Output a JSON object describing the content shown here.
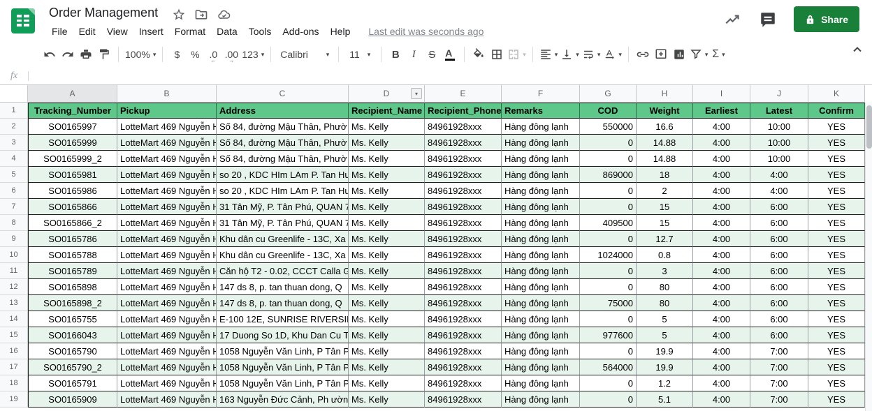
{
  "titlebar": {
    "title": "Order Management",
    "menus": [
      "File",
      "Edit",
      "View",
      "Insert",
      "Format",
      "Data",
      "Tools",
      "Add-ons",
      "Help"
    ],
    "last_edit": "Last edit was seconds ago",
    "share_label": "Share"
  },
  "toolbar": {
    "zoom": "100%",
    "currency": "$",
    "percent": "%",
    "decimal_decrease": ".0",
    "decimal_increase": ".00",
    "more_formats": "123",
    "font_name": "Calibri",
    "font_size": "11",
    "bold": "B",
    "italic": "I",
    "strikethrough": "S",
    "text_color": "A",
    "functions": "Σ"
  },
  "formula_bar": {
    "fx_label": "fx",
    "value": ""
  },
  "grid": {
    "column_letters": [
      "A",
      "B",
      "C",
      "D",
      "E",
      "F",
      "G",
      "H",
      "I",
      "J",
      "K"
    ],
    "selected_column": "A",
    "filter_dropdown_column": "D",
    "row_numbers": [
      1,
      2,
      3,
      4,
      5,
      6,
      7,
      8,
      9,
      10,
      11,
      12,
      13,
      14,
      15,
      16,
      17,
      18,
      19
    ]
  },
  "sheet": {
    "headers": [
      "Tracking_Number",
      "Pickup",
      "Address",
      "Recipient_Name",
      "Recipient_Phone",
      "Remarks",
      "COD",
      "Weight",
      "Earliest",
      "Latest",
      "Confirm"
    ],
    "rows": [
      [
        "SO0165997",
        "LotteMart 469 Nguyễn H",
        "Số 84, đường Mậu Thân, Phườ",
        "Ms. Kelly",
        "84961928xxx",
        "Hàng đông lạnh",
        "550000",
        "16.6",
        "4:00",
        "10:00",
        "YES"
      ],
      [
        "SO0165999",
        "LotteMart 469 Nguyễn H",
        "Số 84, đường Mậu Thân, Phườ",
        "Ms. Kelly",
        "84961928xxx",
        "Hàng đông lạnh",
        "0",
        "14.88",
        "4:00",
        "10:00",
        "YES"
      ],
      [
        "SO0165999_2",
        "LotteMart 469 Nguyễn H",
        "Số 84, đường Mậu Thân, Phườ",
        "Ms. Kelly",
        "84961928xxx",
        "Hàng đông lạnh",
        "0",
        "14.88",
        "4:00",
        "10:00",
        "YES"
      ],
      [
        "SO0165981",
        "LotteMart 469 Nguyễn H",
        "so 20 , KDC HIm LAm P. Tan Hu",
        "Ms. Kelly",
        "84961928xxx",
        "Hàng đông lạnh",
        "869000",
        "18",
        "4:00",
        "4:00",
        "YES"
      ],
      [
        "SO0165986",
        "LotteMart 469 Nguyễn H",
        "so 20 , KDC HIm LAm P. Tan Hu",
        "Ms. Kelly",
        "84961928xxx",
        "Hàng đông lạnh",
        "0",
        "2",
        "4:00",
        "4:00",
        "YES"
      ],
      [
        "SO0165866",
        "LotteMart 469 Nguyễn H",
        "31 Tân Mỹ, P. Tân Phú, QUAN 7",
        "Ms. Kelly",
        "84961928xxx",
        "Hàng đông lạnh",
        "0",
        "15",
        "4:00",
        "6:00",
        "YES"
      ],
      [
        "SO0165866_2",
        "LotteMart 469 Nguyễn H",
        "31 Tân Mỹ, P. Tân Phú, QUAN 7",
        "Ms. Kelly",
        "84961928xxx",
        "Hàng đông lạnh",
        "409500",
        "15",
        "4:00",
        "6:00",
        "YES"
      ],
      [
        "SO0165786",
        "LotteMart 469 Nguyễn H",
        "Khu dân cu Greenlife - 13C, Xa",
        "Ms. Kelly",
        "84961928xxx",
        "Hàng đông lạnh",
        "0",
        "12.7",
        "4:00",
        "6:00",
        "YES"
      ],
      [
        "SO0165788",
        "LotteMart 469 Nguyễn H",
        "Khu dân cu Greenlife - 13C, Xa",
        "Ms. Kelly",
        "84961928xxx",
        "Hàng đông lạnh",
        "1024000",
        "0.8",
        "4:00",
        "6:00",
        "YES"
      ],
      [
        "SO0165789",
        "LotteMart 469 Nguyễn H",
        "Căn hộ T2 - 0.02, CCCT Calla G",
        "Ms. Kelly",
        "84961928xxx",
        "Hàng đông lạnh",
        "0",
        "3",
        "4:00",
        "6:00",
        "YES"
      ],
      [
        "SO0165898",
        "LotteMart 469 Nguyễn H",
        "147 ds 8, p. tan thuan dong, Q",
        "Ms. Kelly",
        "84961928xxx",
        "Hàng đông lạnh",
        "0",
        "80",
        "4:00",
        "6:00",
        "YES"
      ],
      [
        "SO0165898_2",
        "LotteMart 469 Nguyễn H",
        "147 ds 8, p. tan thuan dong, Q",
        "Ms. Kelly",
        "84961928xxx",
        "Hàng đông lạnh",
        "75000",
        "80",
        "4:00",
        "6:00",
        "YES"
      ],
      [
        "SO0165755",
        "LotteMart 469 Nguyễn H",
        "E-100 12E, SUNRISE RIVERSIDE",
        "Ms. Kelly",
        "84961928xxx",
        "Hàng đông lạnh",
        "0",
        "5",
        "4:00",
        "6:00",
        "YES"
      ],
      [
        "SO0166043",
        "LotteMart 469 Nguyễn H",
        "17 Duong So 1D, Khu Dan Cu Tr",
        "Ms. Kelly",
        "84961928xxx",
        "Hàng đông lạnh",
        "977600",
        "5",
        "4:00",
        "6:00",
        "YES"
      ],
      [
        "SO0165790",
        "LotteMart 469 Nguyễn H",
        "1058 Nguyễn Văn Linh, P Tân P",
        "Ms. Kelly",
        "84961928xxx",
        "Hàng đông lạnh",
        "0",
        "19.9",
        "4:00",
        "7:00",
        "YES"
      ],
      [
        "SO0165790_2",
        "LotteMart 469 Nguyễn H",
        "1058 Nguyễn Văn Linh, P Tân P",
        "Ms. Kelly",
        "84961928xxx",
        "Hàng đông lạnh",
        "564000",
        "19.9",
        "4:00",
        "7:00",
        "YES"
      ],
      [
        "SO0165791",
        "LotteMart 469 Nguyễn H",
        "1058 Nguyễn Văn Linh, P Tân P",
        "Ms. Kelly",
        "84961928xxx",
        "Hàng đông lạnh",
        "0",
        "1.2",
        "4:00",
        "7:00",
        "YES"
      ],
      [
        "SO0165909",
        "LotteMart 469 Nguyễn H",
        "163 Nguyễn Đức Cảnh, Ph ườn",
        "Ms. Kelly",
        "84961928xxx",
        "Hàng đông lạnh",
        "0",
        "5.1",
        "4:00",
        "7:00",
        "YES"
      ]
    ]
  },
  "colors": {
    "header_green": "#5dc88a",
    "band_green": "#e7f4ec",
    "share_green": "#188038",
    "logo_green": "#0f9d58"
  }
}
